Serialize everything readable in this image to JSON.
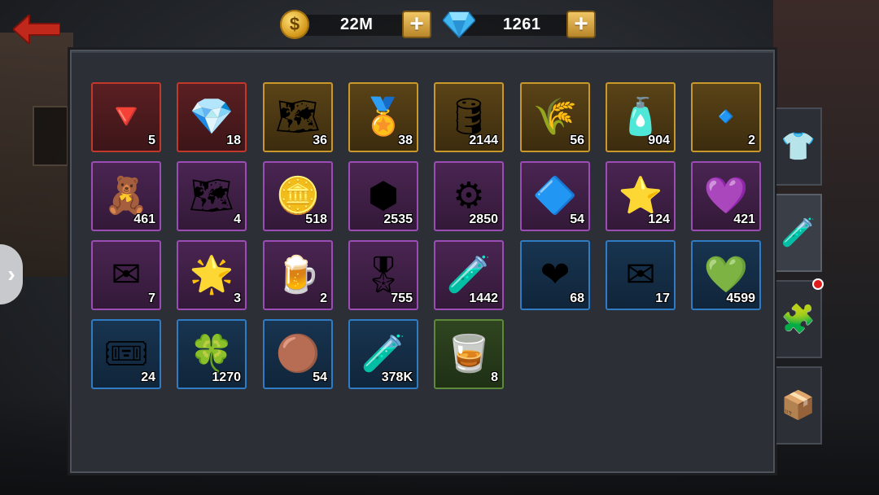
{
  "header": {
    "coins": "22M",
    "gems": "1261",
    "coin_symbol": "$",
    "icons": {
      "back": "back-arrow-icon",
      "coin": "coin-icon",
      "gem": "diamond-icon",
      "plus": "plus-icon"
    }
  },
  "tabs": [
    {
      "icon": "shirt-icon",
      "glyph": "👕",
      "active": false
    },
    {
      "icon": "potion-icon",
      "glyph": "🧪",
      "active": true
    },
    {
      "icon": "puzzle-icon",
      "glyph": "🧩",
      "active": false,
      "notification": true
    },
    {
      "icon": "box-icon",
      "glyph": "📦",
      "active": false
    }
  ],
  "left_handle_glyph": "›",
  "items": [
    {
      "icon": "red-crystal-icon",
      "glyph": "🔻",
      "count": "5",
      "rarity": "red"
    },
    {
      "icon": "ruby-badge-icon",
      "glyph": "💎",
      "count": "18",
      "rarity": "red"
    },
    {
      "icon": "blueprint-card-icon",
      "glyph": "🗺",
      "count": "36",
      "rarity": "gold"
    },
    {
      "icon": "star-medal-icon",
      "glyph": "🏅",
      "count": "38",
      "rarity": "gold"
    },
    {
      "icon": "oil-barrel-icon",
      "glyph": "🛢",
      "count": "2144",
      "rarity": "gold"
    },
    {
      "icon": "wheat-icon",
      "glyph": "🌾",
      "count": "56",
      "rarity": "gold"
    },
    {
      "icon": "gold-capsule-icon",
      "glyph": "🧴",
      "count": "904",
      "rarity": "gold"
    },
    {
      "icon": "silver-crystal-icon",
      "glyph": "🔹",
      "count": "2",
      "rarity": "gold"
    },
    {
      "icon": "teddy-bear-icon",
      "glyph": "🧸",
      "count": "461",
      "rarity": "purple"
    },
    {
      "icon": "map-icon",
      "glyph": "🗺",
      "count": "4",
      "rarity": "purple"
    },
    {
      "icon": "beer-token-icon",
      "glyph": "🪙",
      "count": "518",
      "rarity": "purple"
    },
    {
      "icon": "g-hexagon-icon",
      "glyph": "⬢",
      "count": "2535",
      "rarity": "purple"
    },
    {
      "icon": "gears-icon",
      "glyph": "⚙",
      "count": "2850",
      "rarity": "purple"
    },
    {
      "icon": "blue-crystal-icon",
      "glyph": "🔷",
      "count": "54",
      "rarity": "purple"
    },
    {
      "icon": "rank-star-icon",
      "glyph": "⭐",
      "count": "124",
      "rarity": "purple"
    },
    {
      "icon": "purple-skull-gem-icon",
      "glyph": "💜",
      "count": "421",
      "rarity": "purple"
    },
    {
      "icon": "gold-envelope-icon",
      "glyph": "✉",
      "count": "7",
      "rarity": "purple"
    },
    {
      "icon": "star-coin-icon",
      "glyph": "🌟",
      "count": "3",
      "rarity": "purple"
    },
    {
      "icon": "beer-mug-icon",
      "glyph": "🍺",
      "count": "2",
      "rarity": "purple"
    },
    {
      "icon": "ribbon-medal-icon",
      "glyph": "🎖",
      "count": "755",
      "rarity": "purple"
    },
    {
      "icon": "purple-capsule-icon",
      "glyph": "🧪",
      "count": "1442",
      "rarity": "purple"
    },
    {
      "icon": "heart-icon",
      "glyph": "❤",
      "count": "68",
      "rarity": "blue"
    },
    {
      "icon": "white-envelope-icon",
      "glyph": "✉",
      "count": "17",
      "rarity": "blue"
    },
    {
      "icon": "green-ore-icon",
      "glyph": "💚",
      "count": "4599",
      "rarity": "blue"
    },
    {
      "icon": "ticket-icon",
      "glyph": "🎟",
      "count": "24",
      "rarity": "blue"
    },
    {
      "icon": "clover-chip-icon",
      "glyph": "🍀",
      "count": "1270",
      "rarity": "blue"
    },
    {
      "icon": "bronze-chip-icon",
      "glyph": "🟤",
      "count": "54",
      "rarity": "blue"
    },
    {
      "icon": "green-capsule-icon",
      "glyph": "🧪",
      "count": "378K",
      "rarity": "blue"
    },
    {
      "icon": "shot-glass-icon",
      "glyph": "🥃",
      "count": "8",
      "rarity": "green"
    }
  ]
}
